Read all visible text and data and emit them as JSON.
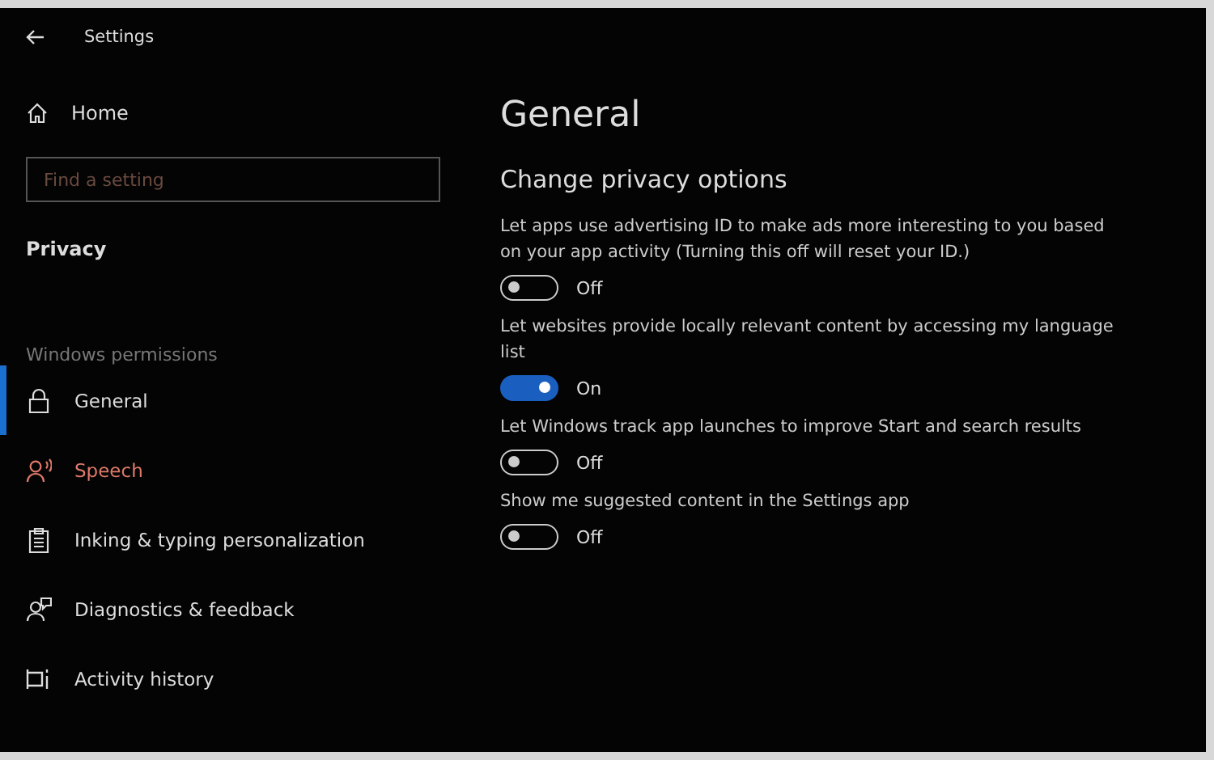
{
  "window": {
    "title": "Settings"
  },
  "sidebar": {
    "home": "Home",
    "search": {
      "placeholder": "Find a setting"
    },
    "section": "Privacy",
    "group": "Windows permissions",
    "items": [
      {
        "label": "General",
        "selected": true
      },
      {
        "label": "Speech",
        "selected": false
      },
      {
        "label": "Inking & typing personalization",
        "selected": false
      },
      {
        "label": "Diagnostics & feedback",
        "selected": false
      },
      {
        "label": "Activity history",
        "selected": false
      }
    ]
  },
  "page": {
    "title": "General",
    "subtitle": "Change privacy options",
    "options": [
      {
        "text": "Let apps use advertising ID to make ads more interesting to you based on your app activity (Turning this off will reset your ID.)",
        "on": false,
        "state": "Off"
      },
      {
        "text": "Let websites provide locally relevant content by accessing my language list",
        "on": true,
        "state": "On"
      },
      {
        "text": "Let Windows track app launches to improve Start and search results",
        "on": false,
        "state": "Off"
      },
      {
        "text": "Show me suggested content in the Settings app",
        "on": false,
        "state": "Off"
      }
    ]
  }
}
